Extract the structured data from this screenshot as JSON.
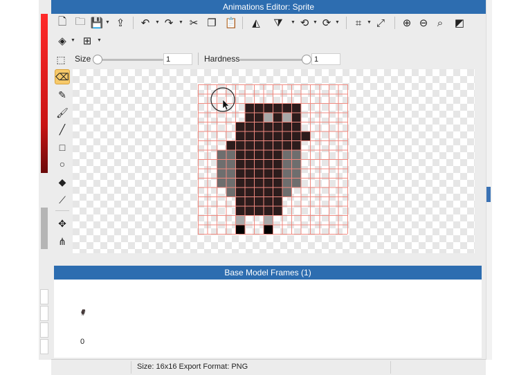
{
  "window": {
    "title": "Animations Editor: Sprite"
  },
  "toolbar": {
    "row1": [
      {
        "name": "new-file-icon",
        "glyph": "🗋"
      },
      {
        "name": "open-folder-icon",
        "glyph": "🗀"
      },
      {
        "name": "save-icon",
        "glyph": "💾"
      },
      {
        "name": "export-icon",
        "glyph": "⇪"
      },
      {
        "name": "undo-icon",
        "glyph": "↶"
      },
      {
        "name": "redo-icon",
        "glyph": "↷"
      },
      {
        "name": "cut-icon",
        "glyph": "✂"
      },
      {
        "name": "copy-icon",
        "glyph": "❐"
      },
      {
        "name": "paste-icon",
        "glyph": "📋"
      },
      {
        "name": "flip-horizontal-icon",
        "glyph": "◭"
      },
      {
        "name": "flip-vertical-icon",
        "glyph": "⧩"
      },
      {
        "name": "rotate-left-icon",
        "glyph": "⟲"
      },
      {
        "name": "rotate-right-icon",
        "glyph": "⟳"
      },
      {
        "name": "crop-icon",
        "glyph": "⌗"
      },
      {
        "name": "resize-icon",
        "glyph": "⤢"
      },
      {
        "name": "zoom-in-icon",
        "glyph": "⊕"
      },
      {
        "name": "zoom-out-icon",
        "glyph": "⊖"
      },
      {
        "name": "zoom-fit-icon",
        "glyph": "⌕"
      },
      {
        "name": "color-toggle-icon",
        "glyph": "◩"
      }
    ],
    "row2": [
      {
        "name": "layers-icon",
        "glyph": "◈"
      },
      {
        "name": "grid-icon",
        "glyph": "⊞"
      }
    ]
  },
  "brush": {
    "size_label": "Size",
    "size_value": "1",
    "hardness_label": "Hardness",
    "hardness_value": "1",
    "size_slider_fraction": 0.0,
    "hardness_slider_fraction": 1.0
  },
  "tools": [
    {
      "name": "eraser-tool-icon",
      "glyph": "⌫",
      "active": true
    },
    {
      "name": "pencil-tool-icon",
      "glyph": "✎",
      "active": false
    },
    {
      "name": "brush-tool-icon",
      "glyph": "🖌",
      "active": false
    },
    {
      "name": "line-tool-icon",
      "glyph": "╱",
      "active": false
    },
    {
      "name": "rectangle-tool-icon",
      "glyph": "□",
      "active": false
    },
    {
      "name": "ellipse-tool-icon",
      "glyph": "○",
      "active": false
    },
    {
      "name": "fill-bucket-tool-icon",
      "glyph": "◆",
      "active": false
    },
    {
      "name": "eyedropper-tool-icon",
      "glyph": "⟋",
      "active": false
    },
    {
      "name": "move-tool-icon",
      "glyph": "✥",
      "active": false
    },
    {
      "name": "pivot-tool-icon",
      "glyph": "⋔",
      "active": false
    }
  ],
  "sprite": {
    "grid_size": 16,
    "colors": {
      "grid": "#f08a80",
      "dark": "#2c1c1c",
      "gray": "#6e6e6e",
      "light": "#a8a8a8",
      "black": "#000000"
    },
    "pixels": [
      "................",
      "................",
      ".....DDDDDD.....",
      ".....DDLDLD.....",
      "....DDDDDDD.....",
      "....DDDDDDDD....",
      "...DDDDDDDD.....",
      "..GGDDDDDGG.....",
      "..GGDDDDDGG.....",
      "..GGDDDDDGG.....",
      "..GGDDDDDGG.....",
      "...GDDDDDG......",
      "....DDDDD.......",
      "....DDDDD.......",
      "....L..L........",
      "....B..B........"
    ]
  },
  "frames": {
    "header": "Base Model Frames (1)",
    "items": [
      {
        "index": "0"
      }
    ]
  },
  "status": {
    "text": "Size: 16x16   Export Format: PNG"
  }
}
